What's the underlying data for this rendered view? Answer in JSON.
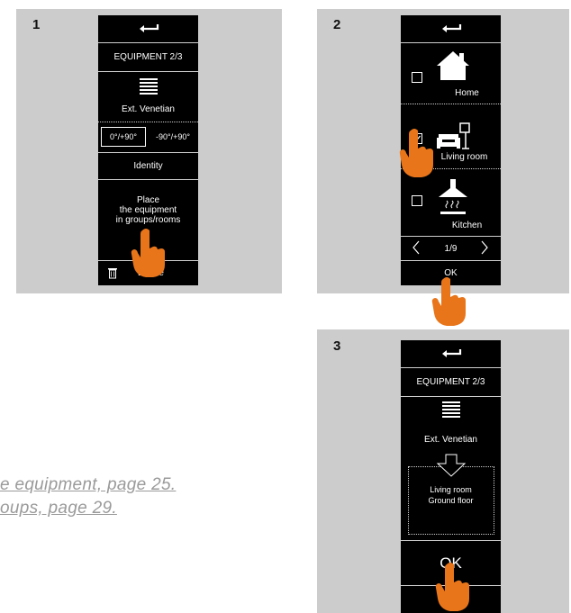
{
  "steps": {
    "s1": "1",
    "s2": "2",
    "s3": "3"
  },
  "screen1": {
    "title": "EQUIPMENT 2/3",
    "device": "Ext. Venetian",
    "range_a": "0°/+90°",
    "range_b": "-90°/+90°",
    "identity": "Identity",
    "place_1": "Place",
    "place_2": "the equipment",
    "place_3": "in groups/rooms",
    "delete": "Delete"
  },
  "screen2": {
    "home": "Home",
    "living": "Living room",
    "kitchen": "Kitchen",
    "page": "1/9",
    "ok": "OK"
  },
  "screen3": {
    "title": "EQUIPMENT 2/3",
    "device": "Ext. Venetian",
    "room": "Living room",
    "floor": "Ground floor",
    "ok": "OK"
  },
  "links": {
    "line1": "e equipment, page 25.",
    "line2": "oups, page 29."
  },
  "colors": {
    "accent": "#e8751a",
    "panel": "#cccccc",
    "screen": "#000000"
  }
}
